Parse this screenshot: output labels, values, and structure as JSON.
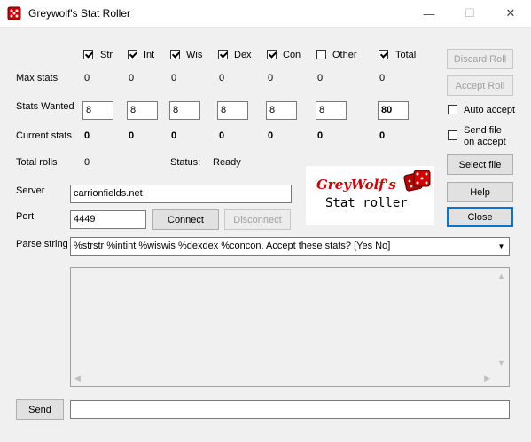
{
  "window": {
    "title": "Greywolf's Stat Roller"
  },
  "stats": {
    "columns": [
      {
        "key": "str",
        "label": "Str",
        "checked": true,
        "max": "0",
        "wanted": "8",
        "current": "0"
      },
      {
        "key": "int",
        "label": "Int",
        "checked": true,
        "max": "0",
        "wanted": "8",
        "current": "0"
      },
      {
        "key": "wis",
        "label": "Wis",
        "checked": true,
        "max": "0",
        "wanted": "8",
        "current": "0"
      },
      {
        "key": "dex",
        "label": "Dex",
        "checked": true,
        "max": "0",
        "wanted": "8",
        "current": "0"
      },
      {
        "key": "con",
        "label": "Con",
        "checked": true,
        "max": "0",
        "wanted": "8",
        "current": "0"
      },
      {
        "key": "other",
        "label": "Other",
        "checked": false,
        "max": "0",
        "wanted": "8",
        "current": "0"
      },
      {
        "key": "total",
        "label": "Total",
        "checked": true,
        "max": "0",
        "wanted": "80",
        "current": "0"
      }
    ],
    "row_labels": {
      "max": "Max stats",
      "wanted": "Stats Wanted",
      "current": "Current stats",
      "total_rolls": "Total rolls"
    },
    "total_rolls_value": "0",
    "status_label": "Status:",
    "status_value": "Ready"
  },
  "right_panel": {
    "discard_roll": "Discard Roll",
    "accept_roll": "Accept Roll",
    "auto_accept": "Auto accept",
    "send_file_line1": "Send file",
    "send_file_line2": "on accept",
    "select_file": "Select file",
    "help": "Help",
    "close": "Close"
  },
  "logo": {
    "script": "GreyWolf's",
    "sub": "Stat roller"
  },
  "connection": {
    "server_label": "Server",
    "server_value": "carrionfields.net",
    "port_label": "Port",
    "port_value": "4449",
    "connect": "Connect",
    "disconnect": "Disconnect"
  },
  "parse": {
    "label": "Parse string",
    "value": "%strstr %intint %wiswis %dexdex %concon. Accept these stats? [Yes No]"
  },
  "send": {
    "button": "Send",
    "input_value": ""
  },
  "colors": {
    "accent": "#0078d7",
    "logo_red": "#d40000"
  }
}
